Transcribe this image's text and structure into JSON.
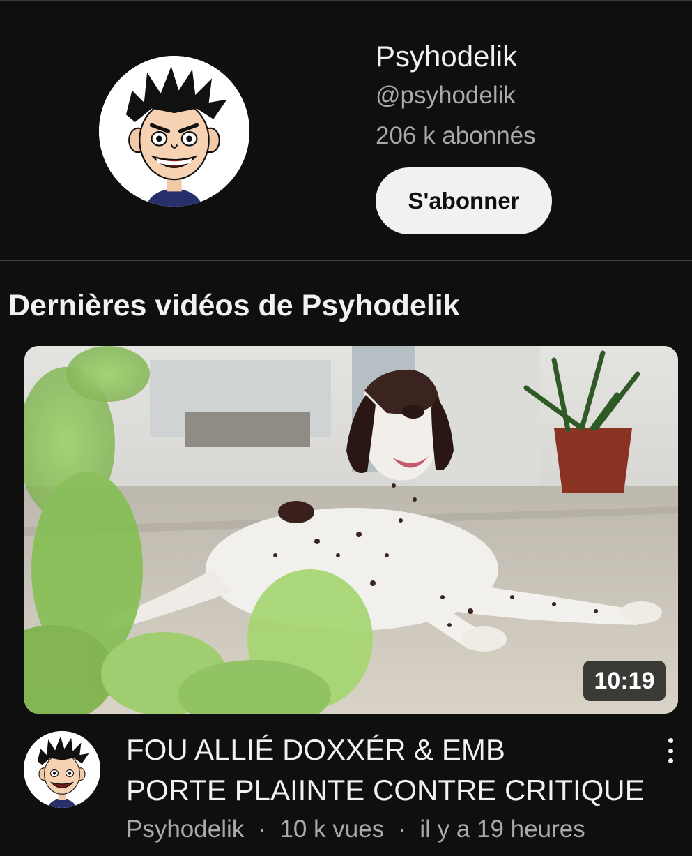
{
  "channel": {
    "name": "Psyhodelik",
    "handle": "@psyhodelik",
    "subscribers": "206 k abonnés",
    "subscribe_label": "S'abonner",
    "avatar_icon": "cartoon-avatar-icon"
  },
  "section": {
    "title": "Dernières vidéos de Psyhodelik"
  },
  "video": {
    "duration": "10:19",
    "title_line1": "FOU ALLIÉ DOXXÉR & EMB",
    "title_line2": "PORTE PLAIINTE CONTRE CRITIQUE",
    "channel": "Psyhodelik",
    "views": "10 k vues",
    "age": "il y a 19 heures",
    "separator": "·",
    "more_icon": "more-vertical-icon"
  },
  "colors": {
    "background": "#0f0f0f",
    "primary_text": "#f1f1f1",
    "secondary_text": "#aaaaaa",
    "subscribe_bg": "#f1f1f1",
    "divider": "#3f3f3f"
  }
}
